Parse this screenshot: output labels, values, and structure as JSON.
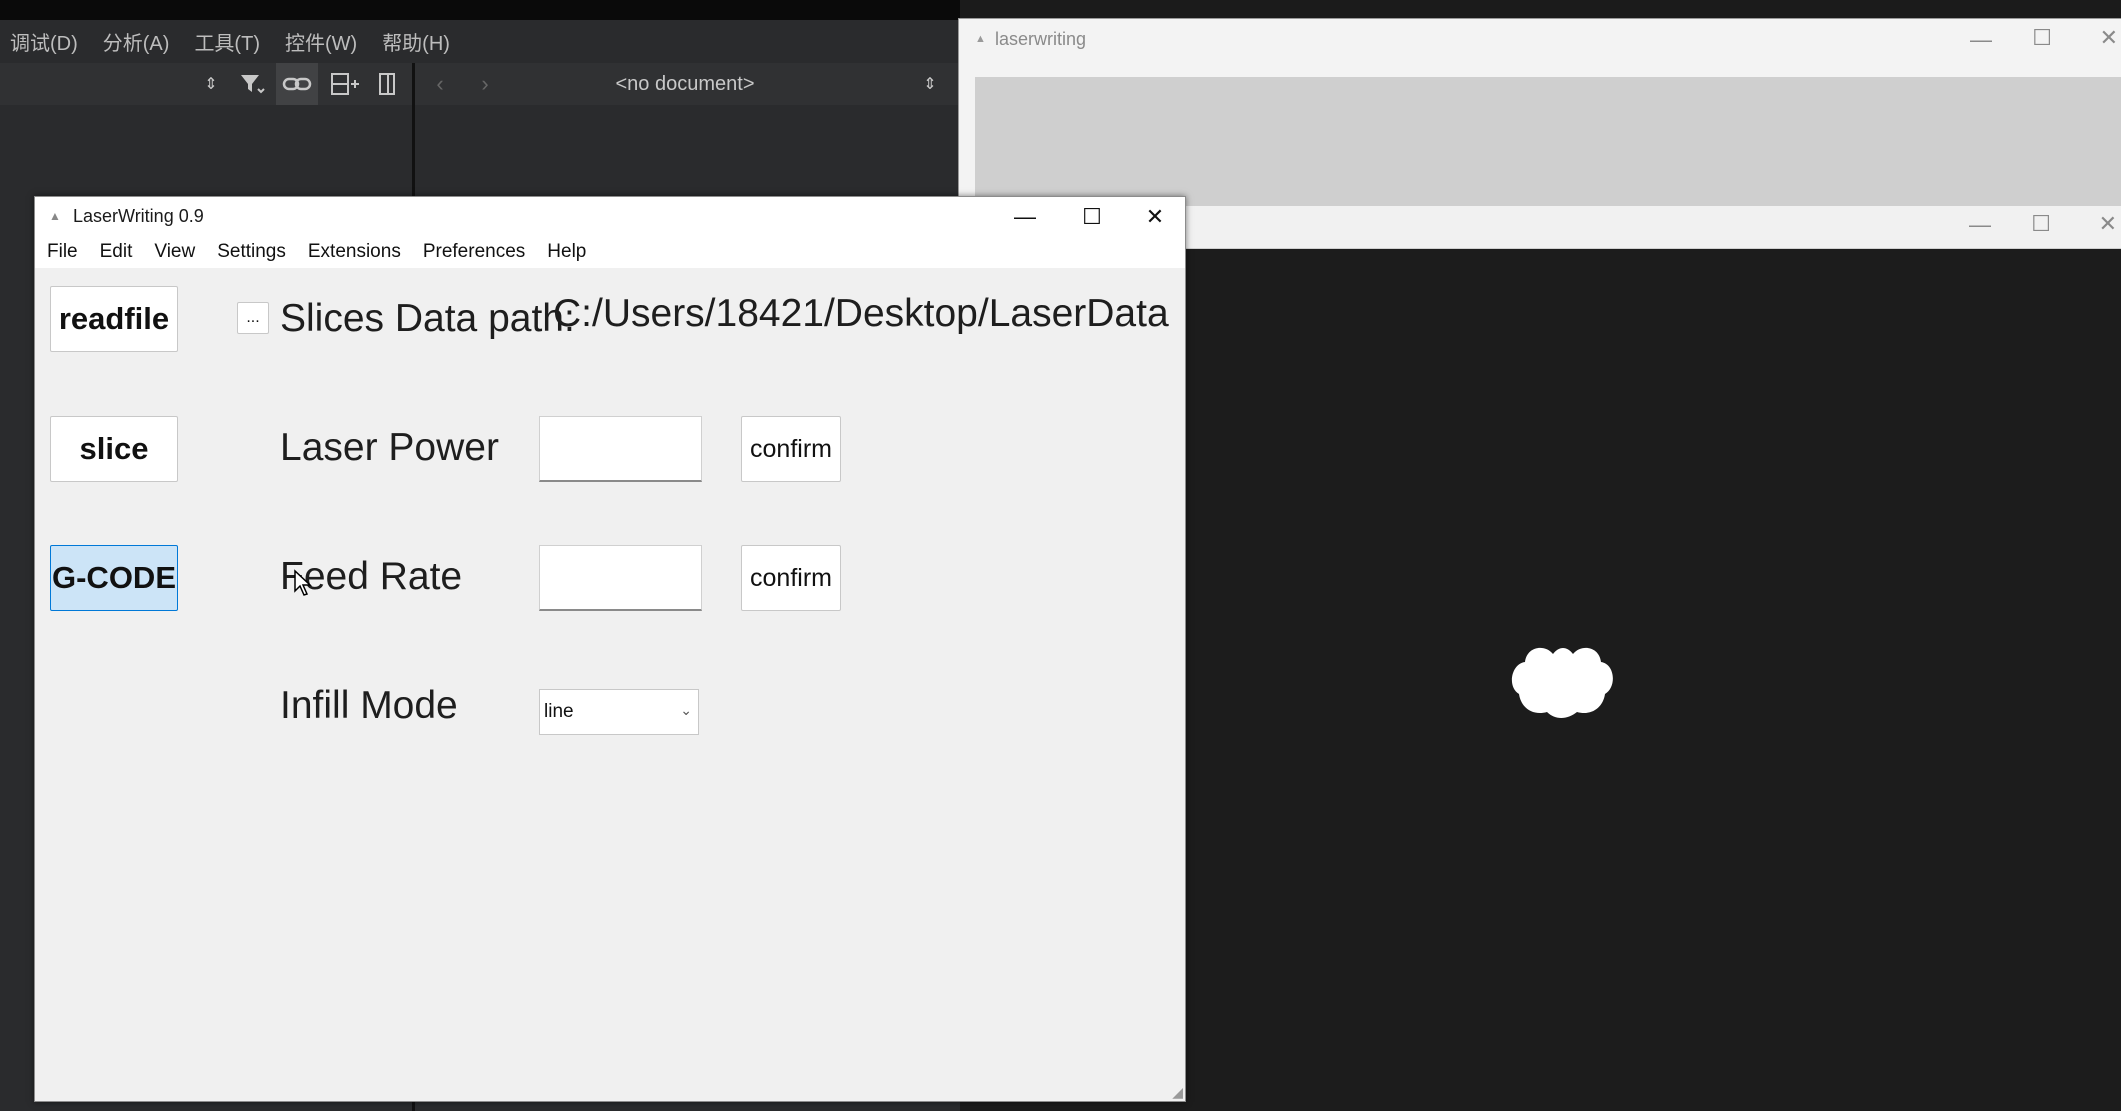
{
  "ide": {
    "menu": [
      "调试(D)",
      "分析(A)",
      "工具(T)",
      "控件(W)",
      "帮助(H)"
    ],
    "doc_combo": "<no document>"
  },
  "bg_window_1": {
    "title": "laserwriting"
  },
  "main_window": {
    "title": "LaserWriting 0.9",
    "menu": [
      "File",
      "Edit",
      "View",
      "Settings",
      "Extensions",
      "Preferences",
      "Help"
    ],
    "buttons": {
      "readfile": "readfile",
      "slice": "slice",
      "gcode": "G-CODE",
      "browse": "..."
    },
    "path_label": "Slices Data path:",
    "path_value": "C:/Users/18421/Desktop/LaserData",
    "laser_power": {
      "label": "Laser  Power",
      "value": "",
      "confirm": "confirm"
    },
    "feed_rate": {
      "label": "Feed Rate",
      "value": "",
      "confirm": "confirm"
    },
    "infill_mode": {
      "label": "Infill Mode",
      "selected": "line"
    }
  },
  "colors": {
    "highlight_button": "#cce4f7",
    "highlight_border": "#0078d7"
  }
}
